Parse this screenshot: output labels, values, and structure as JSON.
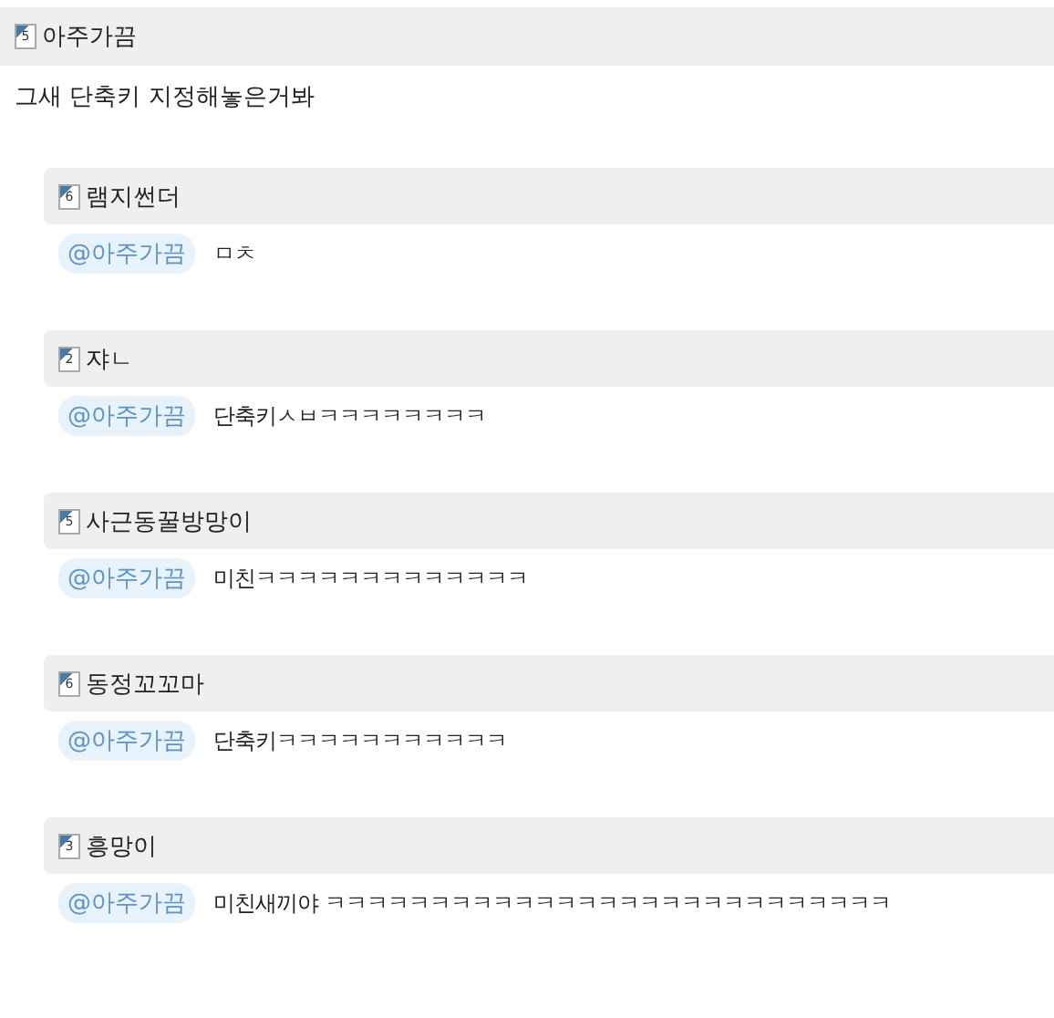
{
  "comment": {
    "level": "5",
    "author": "아주가끔",
    "text": "그새 단축키 지정해놓은거봐"
  },
  "replies": [
    {
      "level": "6",
      "author": "램지썬더",
      "mention": "@아주가끔",
      "text": "ㅁㅊ"
    },
    {
      "level": "2",
      "author": "쟈ㄴ",
      "mention": "@아주가끔",
      "text": "단축키ㅅㅂㅋㅋㅋㅋㅋㅋㅋㅋ"
    },
    {
      "level": "5",
      "author": "사근동꿀방망이",
      "mention": "@아주가끔",
      "text": "미친ㅋㅋㅋㅋㅋㅋㅋㅋㅋㅋㅋㅋㅋ"
    },
    {
      "level": "6",
      "author": "동정꼬꼬마",
      "mention": "@아주가끔",
      "text": "단축키ㅋㅋㅋㅋㅋㅋㅋㅋㅋㅋㅋ"
    },
    {
      "level": "3",
      "author": "흥망이",
      "mention": "@아주가끔",
      "text": "미친새끼야 ㅋㅋㅋㅋㅋㅋㅋㅋㅋㅋㅋㅋㅋㅋㅋㅋㅋㅋㅋㅋㅋㅋㅋㅋㅋㅋㅋ"
    }
  ]
}
